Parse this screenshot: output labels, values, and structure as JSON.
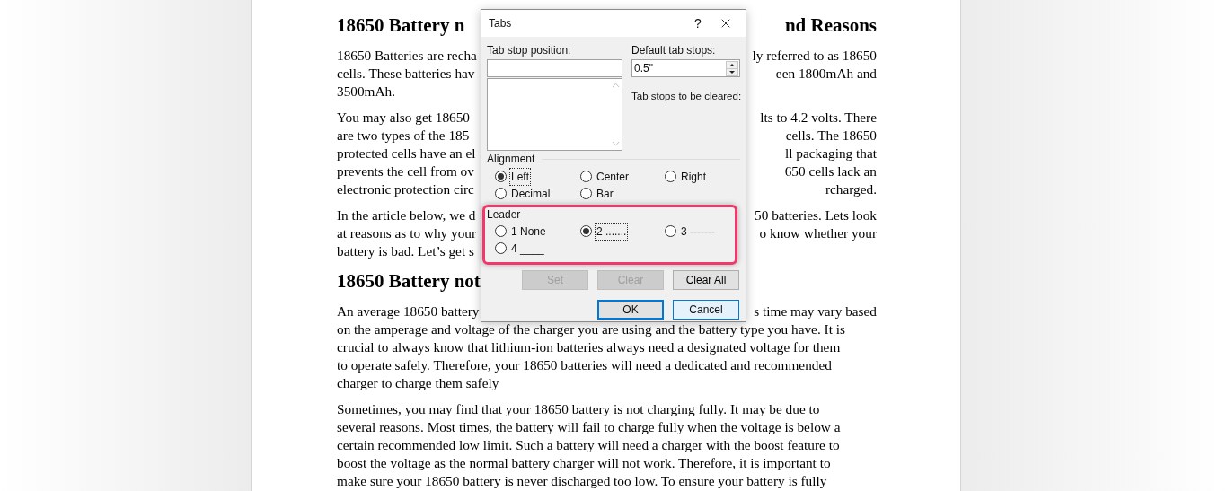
{
  "document": {
    "blocks": [
      {
        "kind": "heading",
        "lines": [
          {
            "left": "18650 Battery n",
            "right": "nd Reasons"
          }
        ]
      },
      {
        "kind": "paragraph",
        "lines": [
          {
            "left": "18650 Batteries are recha",
            "right": "ly referred to as 18650"
          },
          {
            "left": "cells. These batteries hav",
            "right": "een 1800mAh and"
          },
          {
            "left": "3500mAh."
          }
        ]
      },
      {
        "kind": "paragraph",
        "lines": [
          {
            "left": "You may also get 18650",
            "right": "lts to 4.2 volts. There"
          },
          {
            "left": "are two types of the 185",
            "right": "cells. The 18650"
          },
          {
            "left": "protected cells have an el",
            "right": "ll packaging that"
          },
          {
            "left": "prevents the cell from ov",
            "right": "650 cells lack an"
          },
          {
            "left": "electronic protection circ",
            "right": "rcharged."
          }
        ]
      },
      {
        "kind": "paragraph",
        "lines": [
          {
            "left": "In the article below, we d",
            "right": "50 batteries. Lets look"
          },
          {
            "left": "at reasons as to why your",
            "right": "o know whether your"
          },
          {
            "left": "battery is bad. Let’s get s"
          }
        ]
      },
      {
        "kind": "heading",
        "lines": [
          {
            "left": "18650 Battery not"
          }
        ]
      },
      {
        "kind": "paragraph",
        "lines": [
          {
            "left": "An average 18650 battery",
            "right": "s time may vary based"
          },
          {
            "left": "on the amperage and voltage of the charger you are using and the battery type you have. It is"
          },
          {
            "left": "crucial to always know that lithium-ion batteries always need a designated voltage for them"
          },
          {
            "left": "to operate safely. Therefore, your 18650 batteries will need a dedicated and recommended"
          },
          {
            "left": "charger to charge them safely"
          }
        ]
      },
      {
        "kind": "paragraph",
        "lines": [
          {
            "left": "Sometimes, you may find that your 18650 battery is not charging fully. It may be due to"
          },
          {
            "left": "several reasons. Most times, the battery will fail to charge fully when the voltage is below a"
          },
          {
            "left": "certain recommended low limit. Such a battery will need a charger with the boost feature to"
          },
          {
            "left": "boost the voltage as the normal battery charger will not work. Therefore, it is important to"
          },
          {
            "left": "make sure your 18650 battery is never discharged too low.  To ensure your battery is fully"
          }
        ]
      }
    ]
  },
  "dialog": {
    "title": "Tabs",
    "help": "?",
    "tab_stop_position": {
      "label": "Tab stop position:"
    },
    "default_tab_stops": {
      "label": "Default tab stops:",
      "value": "0.5\""
    },
    "clear_label": "Tab stops to be cleared:",
    "alignment": {
      "label": "Alignment",
      "options": [
        {
          "label": "Left",
          "selected": true
        },
        {
          "label": "Center",
          "selected": false
        },
        {
          "label": "Right",
          "selected": false
        },
        {
          "label": "Decimal",
          "selected": false
        },
        {
          "label": "Bar",
          "selected": false
        }
      ]
    },
    "leader": {
      "label": "Leader",
      "highlighted": true,
      "options": [
        {
          "label": "1 None",
          "selected": false
        },
        {
          "label": "2 .......",
          "selected": true
        },
        {
          "label": "3 -------",
          "selected": false
        },
        {
          "label": "4 ____",
          "selected": false
        }
      ]
    },
    "buttons": [
      {
        "label": "Set",
        "disabled": true
      },
      {
        "label": "Clear",
        "disabled": true
      },
      {
        "label": "Clear All",
        "disabled": false
      }
    ],
    "footer_buttons": [
      {
        "label": "OK",
        "default": true
      },
      {
        "label": "Cancel",
        "default": false
      }
    ]
  }
}
